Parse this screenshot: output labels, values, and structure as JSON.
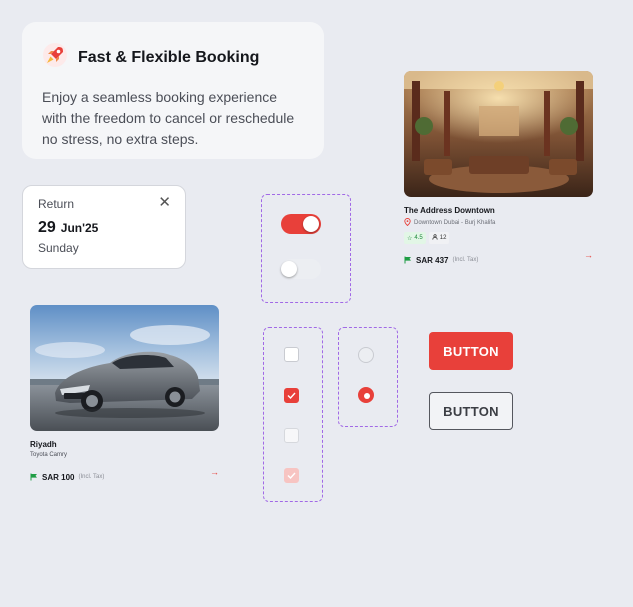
{
  "feature": {
    "title": "Fast & Flexible Booking",
    "description": "Enjoy a seamless booking experience with the freedom to cancel or reschedule no stress, no extra steps.",
    "icon": "rocket-icon"
  },
  "date_card": {
    "label": "Return",
    "day": "29",
    "month_year": "Jun'25",
    "weekday": "Sunday",
    "close_symbol": "✕"
  },
  "toggles": [
    {
      "state": "on"
    },
    {
      "state": "off"
    }
  ],
  "checkboxes": [
    {
      "state": "unchecked"
    },
    {
      "state": "checked"
    },
    {
      "state": "unchecked-disabled"
    },
    {
      "state": "checked-disabled"
    }
  ],
  "radios": [
    {
      "state": "unselected"
    },
    {
      "state": "selected"
    }
  ],
  "buttons": {
    "primary_label": "BUTTON",
    "outline_label": "BUTTON"
  },
  "hotel": {
    "name": "The Address Downtown",
    "location": "Downtown Dubai - Burj Khalifa",
    "rating": "4.5",
    "guests": "12",
    "price": "SAR 437",
    "tax_note": "(Incl. Tax)"
  },
  "car": {
    "city": "Riyadh",
    "model": "Toyota Camry",
    "price": "SAR 100",
    "tax_note": "(Incl. Tax)"
  },
  "colors": {
    "accent": "#e8403a",
    "dashed_border": "#a169e6",
    "background": "#e9ebf1",
    "available_green": "#1f9d45"
  }
}
